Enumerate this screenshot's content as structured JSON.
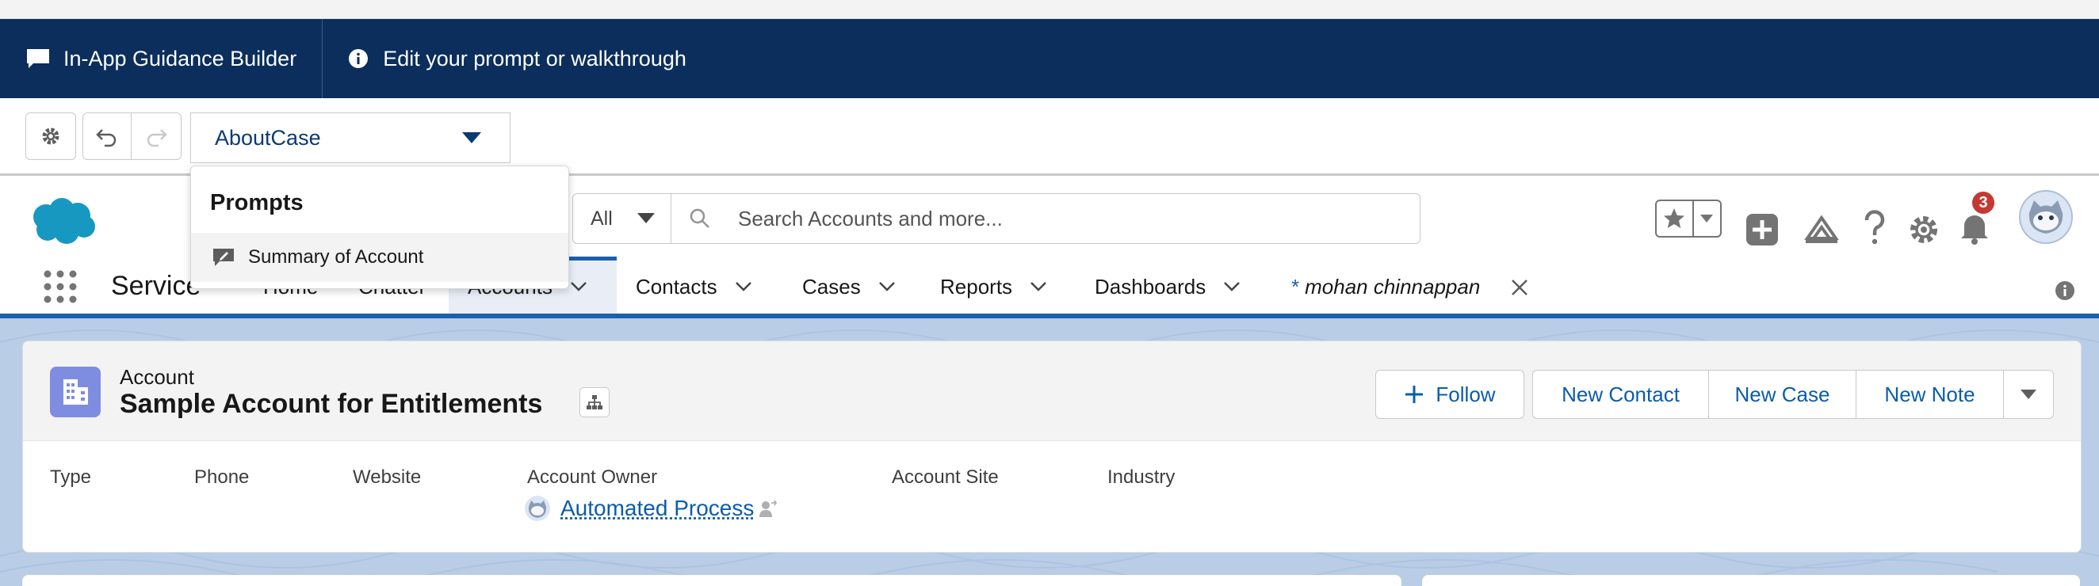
{
  "builder": {
    "title": "In-App Guidance Builder",
    "help_text": "Edit your prompt or walkthrough",
    "selected_item": "AboutCase"
  },
  "dropdown": {
    "section_heading": "Prompts",
    "items": [
      {
        "label": "Summary of Account",
        "icon": "prompt-edit-icon"
      }
    ]
  },
  "global_header": {
    "search_scope": "All",
    "search_placeholder": "Search Accounts and more...",
    "notification_count": "3"
  },
  "nav": {
    "app_name": "Service",
    "items": [
      {
        "label": "Home"
      },
      {
        "label": "Chatter"
      },
      {
        "label": "Accounts",
        "active": true
      },
      {
        "label": "Contacts"
      },
      {
        "label": "Cases"
      },
      {
        "label": "Reports"
      },
      {
        "label": "Dashboards"
      }
    ],
    "open_tab": {
      "prefix": "*",
      "label": "mohan chinnappan"
    }
  },
  "record": {
    "object_type": "Account",
    "name": "Sample Account for Entitlements",
    "actions": {
      "follow": "Follow",
      "new_contact": "New Contact",
      "new_case": "New Case",
      "new_note": "New Note"
    },
    "fields": [
      {
        "label": "Type"
      },
      {
        "label": "Phone"
      },
      {
        "label": "Website"
      },
      {
        "label": "Account Owner",
        "value": "Automated Process"
      },
      {
        "label": "Account Site"
      },
      {
        "label": "Industry"
      }
    ]
  },
  "colors": {
    "builder_bar": "#0b2e5c",
    "brand_blue": "#1b5fad",
    "link_blue": "#0b5cab",
    "account_icon": "#7f8de1",
    "badge_red": "#c23934"
  }
}
